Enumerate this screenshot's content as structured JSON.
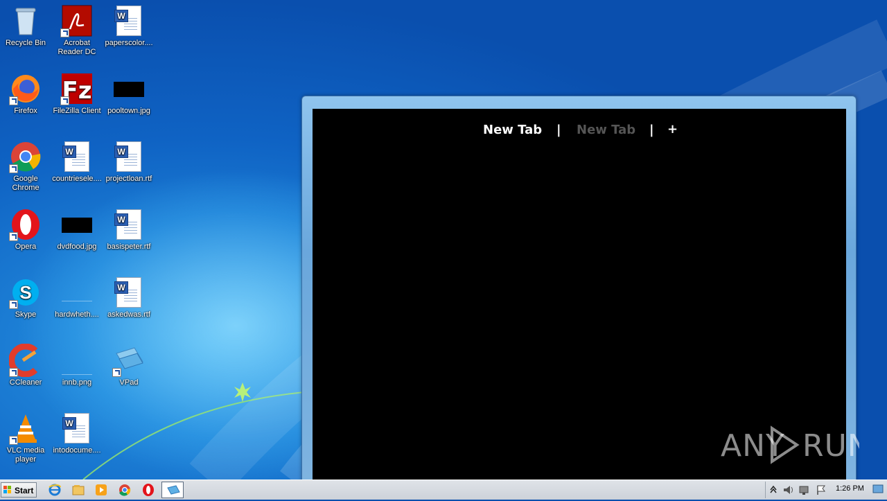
{
  "desktop": {
    "icons": [
      {
        "label": "Recycle Bin",
        "icon": "recycle-bin-icon"
      },
      {
        "label": "Acrobat Reader DC",
        "icon": "acrobat-icon"
      },
      {
        "label": "paperscolor....",
        "icon": "word-doc-icon"
      },
      {
        "label": "Firefox",
        "icon": "firefox-icon"
      },
      {
        "label": "FileZilla Client",
        "icon": "filezilla-icon"
      },
      {
        "label": "pooltown.jpg",
        "icon": "image-file-icon"
      },
      {
        "label": "Google Chrome",
        "icon": "chrome-icon"
      },
      {
        "label": "countriesele....",
        "icon": "word-doc-icon"
      },
      {
        "label": "projectloan.rtf",
        "icon": "word-doc-icon"
      },
      {
        "label": "Opera",
        "icon": "opera-icon"
      },
      {
        "label": "dvdfood.jpg",
        "icon": "image-file-icon"
      },
      {
        "label": "basispeter.rtf",
        "icon": "word-doc-icon"
      },
      {
        "label": "Skype",
        "icon": "skype-icon"
      },
      {
        "label": "hardwheth....",
        "icon": "image-file-icon"
      },
      {
        "label": "askedwas.rtf",
        "icon": "word-doc-icon"
      },
      {
        "label": "CCleaner",
        "icon": "ccleaner-icon"
      },
      {
        "label": "innb.png",
        "icon": "image-file-icon"
      },
      {
        "label": "VPad",
        "icon": "vpad-icon"
      },
      {
        "label": "VLC media player",
        "icon": "vlc-icon"
      },
      {
        "label": "intodocume....",
        "icon": "word-doc-icon"
      }
    ]
  },
  "window": {
    "tabs": [
      {
        "label": "New Tab",
        "active": true
      },
      {
        "label": "New Tab",
        "active": false
      }
    ],
    "separator": "|",
    "new_tab_button": "+"
  },
  "watermark": {
    "text": "ANY RUN"
  },
  "taskbar": {
    "start_label": "Start",
    "pinned": [
      "internet-explorer-icon",
      "file-explorer-icon",
      "media-player-icon",
      "chrome-icon",
      "opera-icon",
      "vpad-icon"
    ],
    "clock": "1:26 PM"
  }
}
